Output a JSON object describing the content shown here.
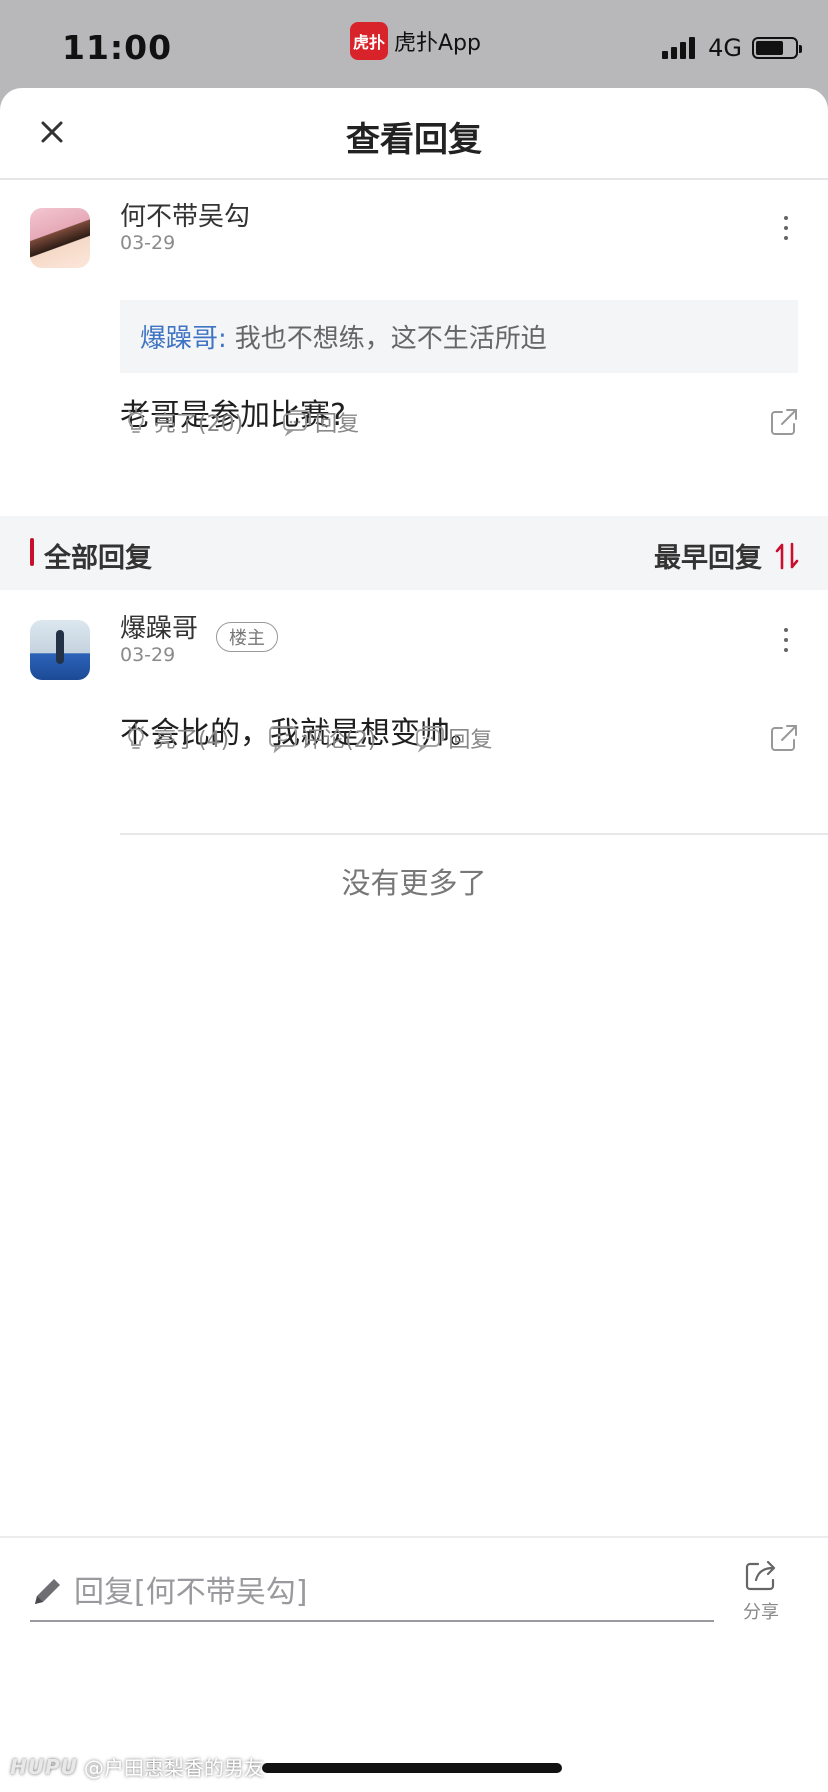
{
  "status_bar": {
    "time": "11:00",
    "app_icon_glyph": "虎扑",
    "app_label": "虎扑App",
    "network": "4G",
    "battery_level": 0.7
  },
  "header": {
    "title": "查看回复",
    "close_icon": "close-icon"
  },
  "main_post": {
    "author": "何不带吴勾",
    "date": "03-29",
    "quote_author": "爆躁哥:",
    "quote_text": "我也不想练，这不生活所迫",
    "content": "老哥是参加比赛?",
    "like_label": "亮了(20)",
    "reply_label": "回复"
  },
  "section": {
    "title": "全部回复",
    "sort_label": "最早回复"
  },
  "reply": {
    "author": "爆躁哥",
    "badge": "楼主",
    "date": "03-29",
    "content": "不会比的，我就是想变帅。",
    "like_label": "亮了(4)",
    "comment_label": "评论(2)",
    "reply_label": "回复"
  },
  "no_more": "没有更多了",
  "bottom_bar": {
    "input_placeholder": "回复[何不带吴勾]",
    "share_label": "分享"
  },
  "watermark": {
    "logo": "HUPU",
    "text": "@户田惠梨香的男友"
  },
  "colors": {
    "accent_red": "#c8102e",
    "quote_blue": "#3f74c4"
  }
}
